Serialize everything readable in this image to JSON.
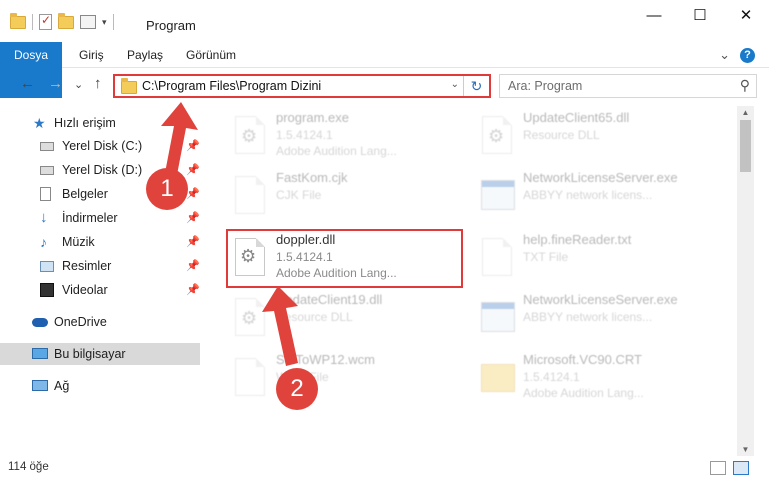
{
  "window": {
    "title": "Program",
    "min": "—",
    "max": "☐",
    "close": "✕"
  },
  "ribbon": {
    "tabs": [
      "Dosya",
      "Giriş",
      "Paylaş",
      "Görünüm"
    ],
    "expand": "⌄",
    "help": "?"
  },
  "nav": {
    "back": "←",
    "forward": "→",
    "recent": "⌄",
    "up": "↑",
    "address": "C:\\Program Files\\Program Dizini",
    "address_dropdown": "⌄",
    "refresh": "↻",
    "search_placeholder": "Ara: Program",
    "search_icon": "⚲"
  },
  "sidebar": {
    "items": [
      {
        "label": "Hızlı erişim",
        "icon": "star-icon"
      },
      {
        "label": "Yerel Disk (C:)",
        "icon": "drive-icon",
        "pin": "📌"
      },
      {
        "label": "Yerel Disk (D:)",
        "icon": "drive-icon",
        "pin": "📌"
      },
      {
        "label": "Belgeler",
        "icon": "documents-icon",
        "pin": "📌"
      },
      {
        "label": "İndirmeler",
        "icon": "downloads-icon",
        "pin": "📌"
      },
      {
        "label": "Müzik",
        "icon": "music-icon",
        "pin": "📌"
      },
      {
        "label": "Resimler",
        "icon": "pictures-icon",
        "pin": "📌"
      },
      {
        "label": "Videolar",
        "icon": "videos-icon",
        "pin": "📌"
      },
      {
        "label": "OneDrive",
        "icon": "cloud-icon"
      },
      {
        "label": "Bu bilgisayar",
        "icon": "computer-icon"
      },
      {
        "label": "Ağ",
        "icon": "network-icon"
      }
    ]
  },
  "files": [
    {
      "name": "program.exe",
      "line2": "1.5.4124.1",
      "line3": "Adobe Audition Lang..."
    },
    {
      "name": "UpdateClient65.dll",
      "line2": "Resource DLL",
      "line3": ""
    },
    {
      "name": "FastKom.cjk",
      "line2": "CJK File",
      "line3": ""
    },
    {
      "name": "NetworkLicenseServer.exe",
      "line2": "ABBYY network licens...",
      "line3": ""
    },
    {
      "name": "doppler.dll",
      "line2": "1.5.4124.1",
      "line3": "Adobe Audition Lang..."
    },
    {
      "name": "help.fineReader.txt",
      "line2": "TXT File",
      "line3": ""
    },
    {
      "name": "UpdateClient19.dll",
      "line2": "Resource DLL",
      "line3": ""
    },
    {
      "name": "NetworkLicenseServer.exe",
      "line2": "ABBYY network licens...",
      "line3": ""
    },
    {
      "name": "StdToWP12.wcm",
      "line2": "WCM File",
      "line3": ""
    },
    {
      "name": "Microsoft.VC90.CRT",
      "line2": "1.5.4124.1",
      "line3": "Adobe Audition Lang..."
    }
  ],
  "annotations": {
    "badge1": "1",
    "badge2": "2"
  },
  "status": {
    "count": "114 öğe"
  },
  "colors": {
    "accent": "#1979ca",
    "highlight": "#e03a3a",
    "selected": "#d9d9d9"
  }
}
